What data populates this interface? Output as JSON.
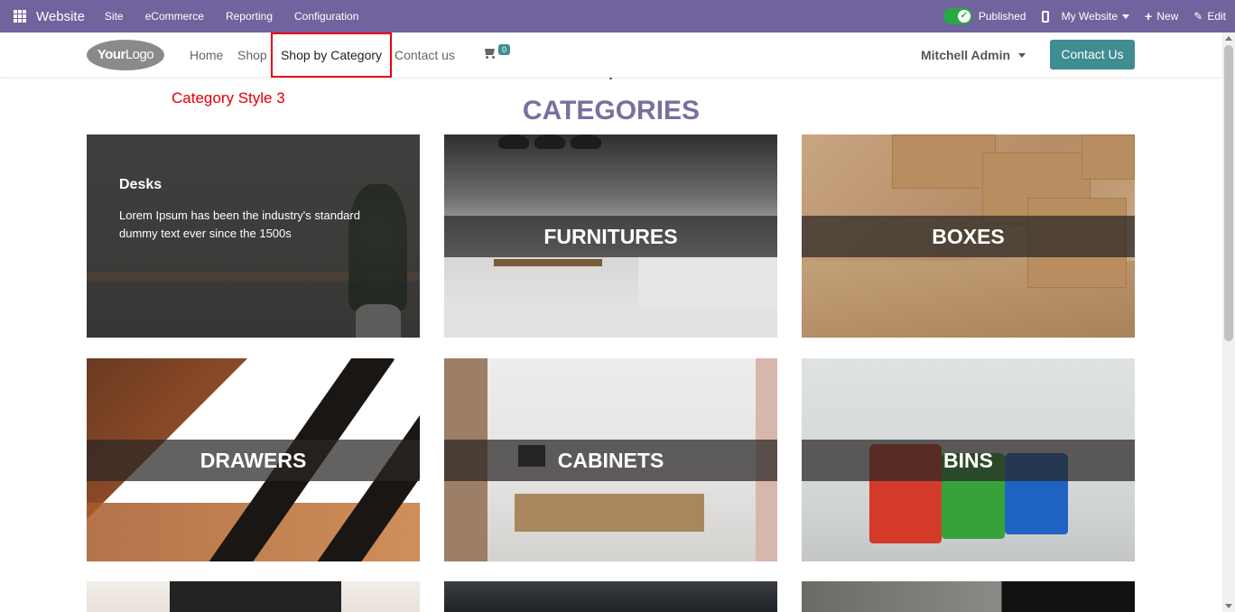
{
  "admin_bar": {
    "brand": "Website",
    "menu": [
      "Site",
      "eCommerce",
      "Reporting",
      "Configuration"
    ],
    "published_label": "Published",
    "website_label": "My Website",
    "new_label": "New",
    "edit_label": "Edit",
    "bg_color": "#71639e"
  },
  "header": {
    "logo_text_bold": "Your",
    "logo_text": "Logo",
    "nav": {
      "home": "Home",
      "shop": "Shop",
      "shop_by_category": "Shop by Category",
      "contact": "Contact us"
    },
    "cart_count": "0",
    "user": "Mitchell Admin",
    "cta": "Contact Us"
  },
  "annotation": "Category Style 3",
  "section_title": "CATEGORIES",
  "categories": [
    {
      "name": "Desks",
      "description": "Lorem Ipsum has been the industry's standard dummy text ever since the 1500s"
    },
    {
      "name": "FURNITURES"
    },
    {
      "name": "BOXES"
    },
    {
      "name": "DRAWERS"
    },
    {
      "name": "CABINETS"
    },
    {
      "name": "BINS"
    }
  ],
  "colors": {
    "accent": "#3f8d90",
    "title": "#77719e",
    "highlight": "#e8000b"
  }
}
